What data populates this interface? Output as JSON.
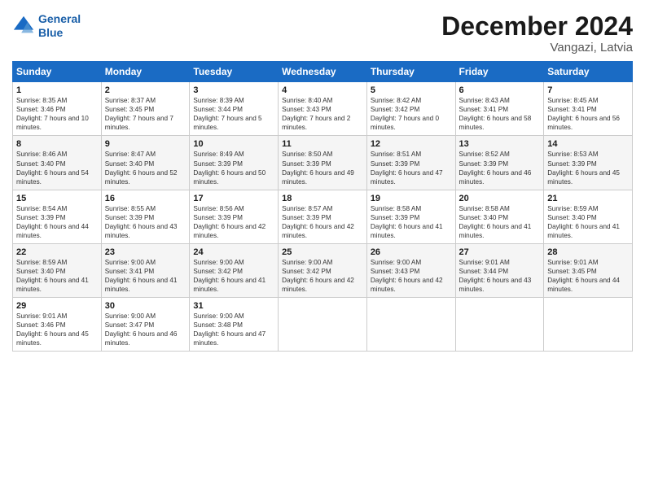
{
  "logo": {
    "line1": "General",
    "line2": "Blue"
  },
  "title": "December 2024",
  "subtitle": "Vangazi, Latvia",
  "days_of_week": [
    "Sunday",
    "Monday",
    "Tuesday",
    "Wednesday",
    "Thursday",
    "Friday",
    "Saturday"
  ],
  "weeks": [
    [
      {
        "day": 1,
        "sunrise": "8:35 AM",
        "sunset": "3:46 PM",
        "daylight": "7 hours and 10 minutes."
      },
      {
        "day": 2,
        "sunrise": "8:37 AM",
        "sunset": "3:45 PM",
        "daylight": "7 hours and 7 minutes."
      },
      {
        "day": 3,
        "sunrise": "8:39 AM",
        "sunset": "3:44 PM",
        "daylight": "7 hours and 5 minutes."
      },
      {
        "day": 4,
        "sunrise": "8:40 AM",
        "sunset": "3:43 PM",
        "daylight": "7 hours and 2 minutes."
      },
      {
        "day": 5,
        "sunrise": "8:42 AM",
        "sunset": "3:42 PM",
        "daylight": "7 hours and 0 minutes."
      },
      {
        "day": 6,
        "sunrise": "8:43 AM",
        "sunset": "3:41 PM",
        "daylight": "6 hours and 58 minutes."
      },
      {
        "day": 7,
        "sunrise": "8:45 AM",
        "sunset": "3:41 PM",
        "daylight": "6 hours and 56 minutes."
      }
    ],
    [
      {
        "day": 8,
        "sunrise": "8:46 AM",
        "sunset": "3:40 PM",
        "daylight": "6 hours and 54 minutes."
      },
      {
        "day": 9,
        "sunrise": "8:47 AM",
        "sunset": "3:40 PM",
        "daylight": "6 hours and 52 minutes."
      },
      {
        "day": 10,
        "sunrise": "8:49 AM",
        "sunset": "3:39 PM",
        "daylight": "6 hours and 50 minutes."
      },
      {
        "day": 11,
        "sunrise": "8:50 AM",
        "sunset": "3:39 PM",
        "daylight": "6 hours and 49 minutes."
      },
      {
        "day": 12,
        "sunrise": "8:51 AM",
        "sunset": "3:39 PM",
        "daylight": "6 hours and 47 minutes."
      },
      {
        "day": 13,
        "sunrise": "8:52 AM",
        "sunset": "3:39 PM",
        "daylight": "6 hours and 46 minutes."
      },
      {
        "day": 14,
        "sunrise": "8:53 AM",
        "sunset": "3:39 PM",
        "daylight": "6 hours and 45 minutes."
      }
    ],
    [
      {
        "day": 15,
        "sunrise": "8:54 AM",
        "sunset": "3:39 PM",
        "daylight": "6 hours and 44 minutes."
      },
      {
        "day": 16,
        "sunrise": "8:55 AM",
        "sunset": "3:39 PM",
        "daylight": "6 hours and 43 minutes."
      },
      {
        "day": 17,
        "sunrise": "8:56 AM",
        "sunset": "3:39 PM",
        "daylight": "6 hours and 42 minutes."
      },
      {
        "day": 18,
        "sunrise": "8:57 AM",
        "sunset": "3:39 PM",
        "daylight": "6 hours and 42 minutes."
      },
      {
        "day": 19,
        "sunrise": "8:58 AM",
        "sunset": "3:39 PM",
        "daylight": "6 hours and 41 minutes."
      },
      {
        "day": 20,
        "sunrise": "8:58 AM",
        "sunset": "3:40 PM",
        "daylight": "6 hours and 41 minutes."
      },
      {
        "day": 21,
        "sunrise": "8:59 AM",
        "sunset": "3:40 PM",
        "daylight": "6 hours and 41 minutes."
      }
    ],
    [
      {
        "day": 22,
        "sunrise": "8:59 AM",
        "sunset": "3:40 PM",
        "daylight": "6 hours and 41 minutes."
      },
      {
        "day": 23,
        "sunrise": "9:00 AM",
        "sunset": "3:41 PM",
        "daylight": "6 hours and 41 minutes."
      },
      {
        "day": 24,
        "sunrise": "9:00 AM",
        "sunset": "3:42 PM",
        "daylight": "6 hours and 41 minutes."
      },
      {
        "day": 25,
        "sunrise": "9:00 AM",
        "sunset": "3:42 PM",
        "daylight": "6 hours and 42 minutes."
      },
      {
        "day": 26,
        "sunrise": "9:00 AM",
        "sunset": "3:43 PM",
        "daylight": "6 hours and 42 minutes."
      },
      {
        "day": 27,
        "sunrise": "9:01 AM",
        "sunset": "3:44 PM",
        "daylight": "6 hours and 43 minutes."
      },
      {
        "day": 28,
        "sunrise": "9:01 AM",
        "sunset": "3:45 PM",
        "daylight": "6 hours and 44 minutes."
      }
    ],
    [
      {
        "day": 29,
        "sunrise": "9:01 AM",
        "sunset": "3:46 PM",
        "daylight": "6 hours and 45 minutes."
      },
      {
        "day": 30,
        "sunrise": "9:00 AM",
        "sunset": "3:47 PM",
        "daylight": "6 hours and 46 minutes."
      },
      {
        "day": 31,
        "sunrise": "9:00 AM",
        "sunset": "3:48 PM",
        "daylight": "6 hours and 47 minutes."
      },
      null,
      null,
      null,
      null
    ]
  ]
}
